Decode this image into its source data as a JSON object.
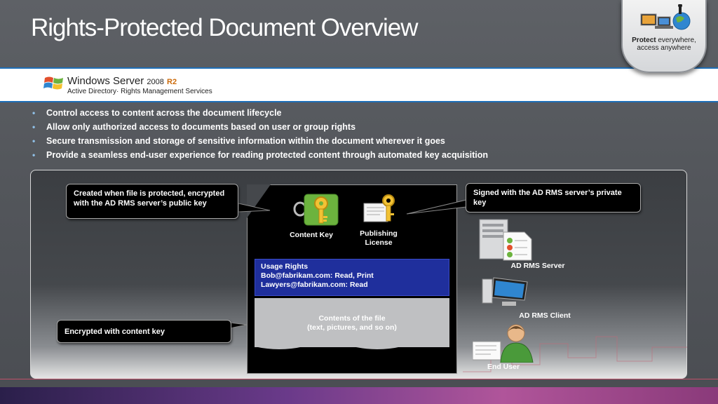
{
  "slide": {
    "title": "Rights-Protected Document Overview"
  },
  "badge": {
    "bold": "Protect",
    "line1_rest": " everywhere,",
    "line2": "access anywhere"
  },
  "logo": {
    "product": "Windows Server",
    "year": "2008",
    "release": "R2",
    "subtitle": "Active Directory· Rights Management Services"
  },
  "bullets": [
    "Control access to content across the document lifecycle",
    "Allow only authorized access to documents based on user or group rights",
    "Secure transmission and storage of sensitive information within the document wherever it goes",
    "Provide a seamless end-user experience for reading protected content through automated key acquisition"
  ],
  "diagram": {
    "callout_content_key": "Created when file is protected, encrypted with the AD RMS server’s public key",
    "callout_publishing_license": "Signed with the AD RMS server’s private key",
    "callout_encrypted": "Encrypted with content key",
    "content_key_label": "Content Key",
    "publishing_license_label_1": "Publishing",
    "publishing_license_label_2": "License",
    "usage_rights": {
      "heading": "Usage Rights",
      "line1": "Bob@fabrikam.com: Read, Print",
      "line2": "Lawyers@fabrikam.com: Read"
    },
    "contents_line1": "Contents of the file",
    "contents_line2": "(text, pictures, and so on)",
    "server_label": "AD RMS Server",
    "client_label": "AD RMS Client",
    "end_user_label": "End User"
  },
  "colors": {
    "background": "#54575c",
    "usage_rights_fill": "#1f2f9c",
    "key_tile": "#6cb33e",
    "accent_blue": "#1f6fb8"
  }
}
